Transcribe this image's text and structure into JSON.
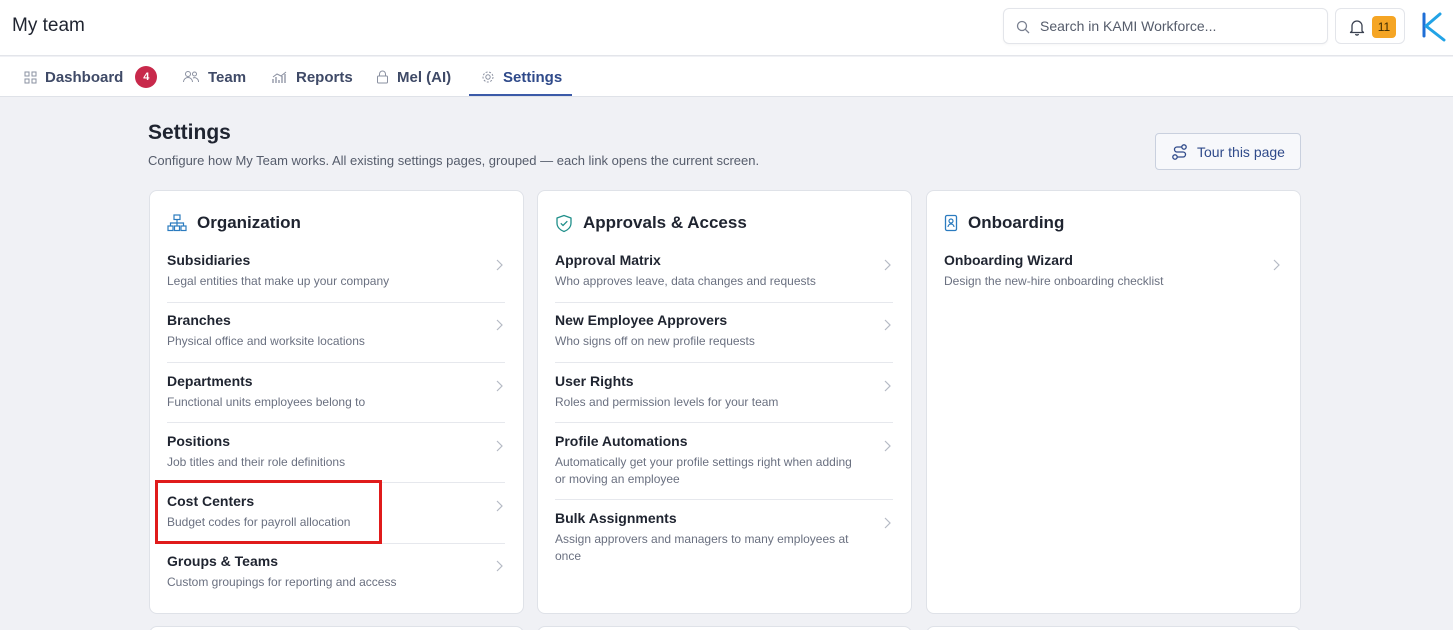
{
  "header": {
    "title": "My team",
    "search_placeholder": "Search in KAMI Workforce...",
    "notification_count": "11"
  },
  "tabs": [
    {
      "label": "Dashboard",
      "badge": "4",
      "icon": "grid-icon"
    },
    {
      "label": "Team",
      "icon": "users-icon"
    },
    {
      "label": "Reports",
      "icon": "chart-icon"
    },
    {
      "label": "Mel (AI)",
      "icon": "lock-icon"
    },
    {
      "label": "Settings",
      "icon": "gear-icon",
      "active": true
    }
  ],
  "page": {
    "title": "Settings",
    "subtitle": "Configure how My Team works. All existing settings pages, grouped — each link opens the current screen.",
    "tour_label": "Tour this page"
  },
  "cards": [
    {
      "title": "Organization",
      "icon": "org-chart-icon",
      "items": [
        {
          "title": "Subsidiaries",
          "desc": "Legal entities that make up your company"
        },
        {
          "title": "Branches",
          "desc": "Physical office and worksite locations"
        },
        {
          "title": "Departments",
          "desc": "Functional units employees belong to"
        },
        {
          "title": "Positions",
          "desc": "Job titles and their role definitions"
        },
        {
          "title": "Cost Centers",
          "desc": "Budget codes for payroll allocation"
        },
        {
          "title": "Groups & Teams",
          "desc": "Custom groupings for reporting and access"
        }
      ]
    },
    {
      "title": "Approvals & Access",
      "icon": "shield-check-icon",
      "items": [
        {
          "title": "Approval Matrix",
          "desc": "Who approves leave, data changes and requests"
        },
        {
          "title": "New Employee Approvers",
          "desc": "Who signs off on new profile requests"
        },
        {
          "title": "User Rights",
          "desc": "Roles and permission levels for your team"
        },
        {
          "title": "Profile Automations",
          "desc": "Automatically get your profile settings right when adding or moving an employee"
        },
        {
          "title": "Bulk Assignments",
          "desc": "Assign approvers and managers to many employees at once"
        }
      ]
    },
    {
      "title": "Onboarding",
      "icon": "id-badge-icon",
      "items": [
        {
          "title": "Onboarding Wizard",
          "desc": "Design the new-hire onboarding checklist"
        }
      ]
    }
  ],
  "colors": {
    "accent": "#2f4a8a",
    "badge_red": "#c8294b",
    "notification_orange": "#f5a524",
    "highlight_red": "#e01b1b",
    "page_bg": "#f0f1f5"
  }
}
